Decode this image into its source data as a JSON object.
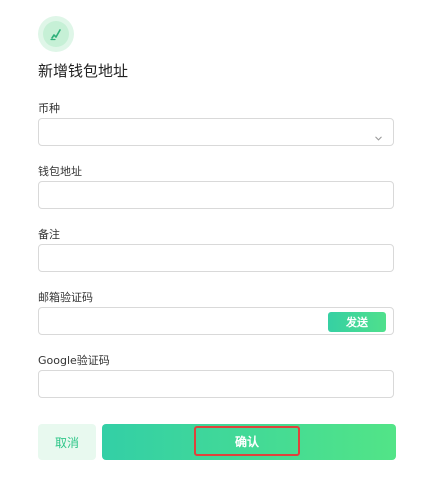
{
  "header": {
    "icon": "wallet-edit-icon",
    "title": "新增钱包地址"
  },
  "form": {
    "currency": {
      "label": "币种",
      "value": "",
      "icon": "chevron-down-icon"
    },
    "address": {
      "label": "钱包地址",
      "value": ""
    },
    "remark": {
      "label": "备注",
      "value": ""
    },
    "email_code": {
      "label": "邮箱验证码",
      "value": "",
      "send_label": "发送"
    },
    "google_code": {
      "label": "Google验证码",
      "value": ""
    }
  },
  "actions": {
    "cancel_label": "取消",
    "confirm_label": "确认"
  },
  "colors": {
    "accent": "#36d0a3",
    "accent_end": "#4fe08c",
    "cancel_bg": "#e8f9ef",
    "highlight": "#e0413b"
  }
}
